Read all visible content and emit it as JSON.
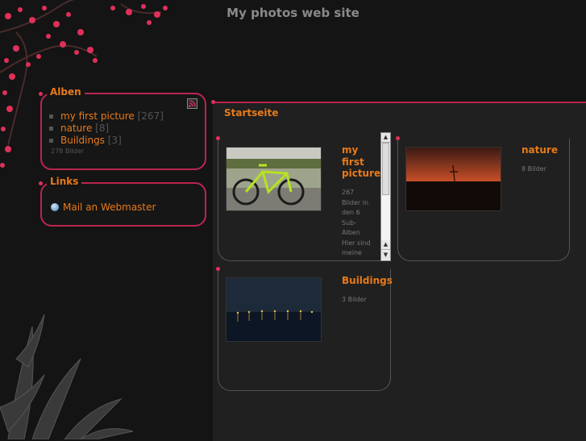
{
  "site_title": "My photos web site",
  "sidebar": {
    "albums_box": {
      "title": "Alben",
      "items": [
        {
          "label": "my first picture",
          "count": "[267]"
        },
        {
          "label": "nature",
          "count": "[8]"
        },
        {
          "label": "Buildings",
          "count": "[3]"
        }
      ],
      "total": "278 Bilder"
    },
    "links_box": {
      "title": "Links",
      "items": [
        {
          "label": "Mail an Webmaster",
          "icon": "globe-icon"
        }
      ]
    }
  },
  "main": {
    "title": "Startseite",
    "albums": [
      {
        "name_lines": [
          "my",
          "first",
          "picture"
        ],
        "description": [
          "267",
          "Bilder in",
          "den 6",
          "Sub-",
          "Alben",
          "Hier sind",
          "meine"
        ],
        "thumb": "bicycle"
      },
      {
        "name_lines": [
          "nature"
        ],
        "description": [
          "8 Bilder"
        ],
        "thumb": "sunset"
      },
      {
        "name_lines": [
          "Buildings"
        ],
        "description": [
          "3 Bilder"
        ],
        "thumb": "pier-night"
      }
    ]
  },
  "colors": {
    "accent": "#e87a1a",
    "border": "#b8264f",
    "background": "#141414",
    "panel": "#202020"
  }
}
